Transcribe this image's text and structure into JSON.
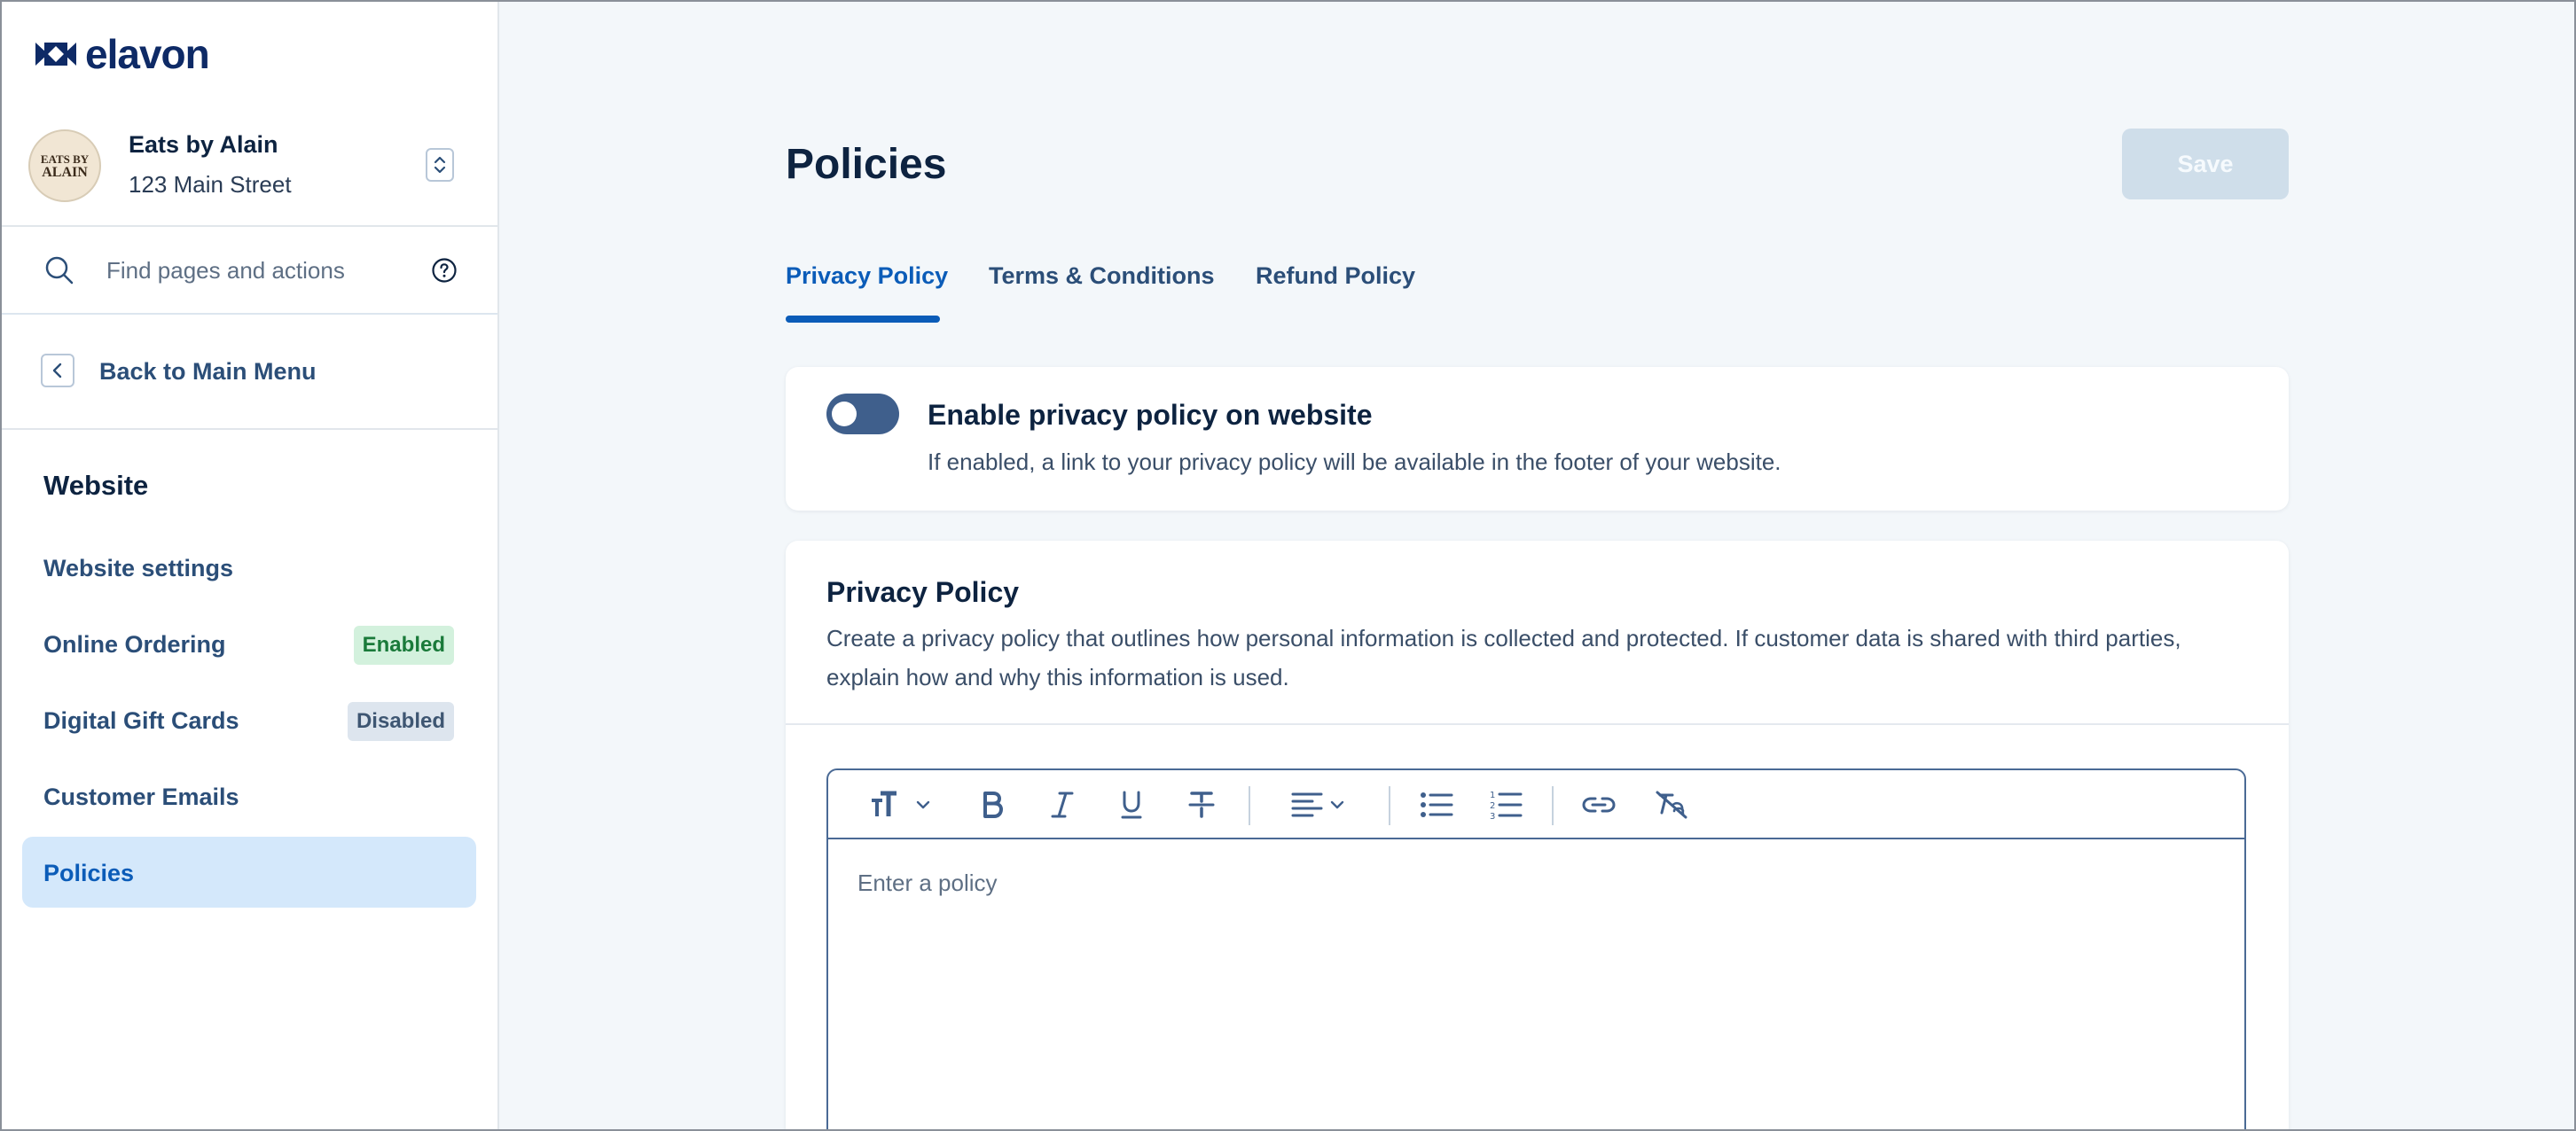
{
  "brand": {
    "name": "elavon"
  },
  "account": {
    "name": "Eats by Alain",
    "address": "123 Main Street",
    "logo_line1": "EATS BY",
    "logo_line2": "ALAIN"
  },
  "search": {
    "placeholder": "Find pages and actions"
  },
  "back": {
    "label": "Back to Main Menu"
  },
  "sidebar": {
    "section_title": "Website",
    "items": [
      {
        "label": "Website settings",
        "badge": ""
      },
      {
        "label": "Online Ordering",
        "badge": "Enabled"
      },
      {
        "label": "Digital Gift Cards",
        "badge": "Disabled"
      },
      {
        "label": "Customer Emails",
        "badge": ""
      },
      {
        "label": "Policies",
        "badge": "",
        "active": true
      }
    ]
  },
  "page": {
    "title": "Policies",
    "save_label": "Save"
  },
  "tabs": [
    {
      "label": "Privacy Policy",
      "active": true
    },
    {
      "label": "Terms & Conditions"
    },
    {
      "label": "Refund Policy"
    }
  ],
  "toggle_card": {
    "title": "Enable privacy policy on website",
    "description": "If enabled, a link to your privacy policy will be available in the footer of your website.",
    "enabled": false
  },
  "policy_card": {
    "title": "Privacy Policy",
    "description": "Create a privacy policy that outlines how personal information is collected and protected. If customer data is shared with third parties, explain how and why this information is used.",
    "editor_placeholder": "Enter a policy"
  },
  "colors": {
    "accent": "#0b5cb8",
    "navy": "#0d2340",
    "enabled_badge_bg": "#d3f1dd",
    "disabled_badge_bg": "#dde5ee"
  },
  "icons": {
    "toolbar": [
      "text-size-icon",
      "bold-icon",
      "italic-icon",
      "underline-icon",
      "strikethrough-icon",
      "align-left-icon",
      "bullet-list-icon",
      "numbered-list-icon",
      "link-icon",
      "clear-format-icon"
    ]
  }
}
